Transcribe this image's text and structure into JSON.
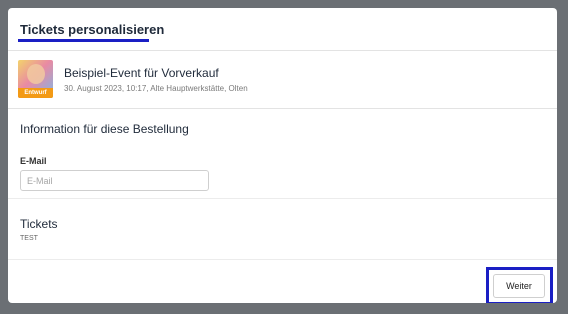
{
  "header": {
    "title": "Tickets personalisieren"
  },
  "event": {
    "badge": "Entwurf",
    "name": "Beispiel-Event für Vorverkauf",
    "meta": "30. August 2023, 10:17, Alte Hauptwerkstätte, Olten"
  },
  "order_info": {
    "title": "Information für diese Bestellung",
    "email_label": "E-Mail",
    "email_placeholder": "E-Mail",
    "email_value": ""
  },
  "tickets": {
    "title": "Tickets",
    "subtitle": "TEST"
  },
  "footer": {
    "next_label": "Weiter"
  },
  "colors": {
    "accent": "#1a1fc4",
    "badge": "#f39a15",
    "backdrop": "#6b6f74"
  }
}
